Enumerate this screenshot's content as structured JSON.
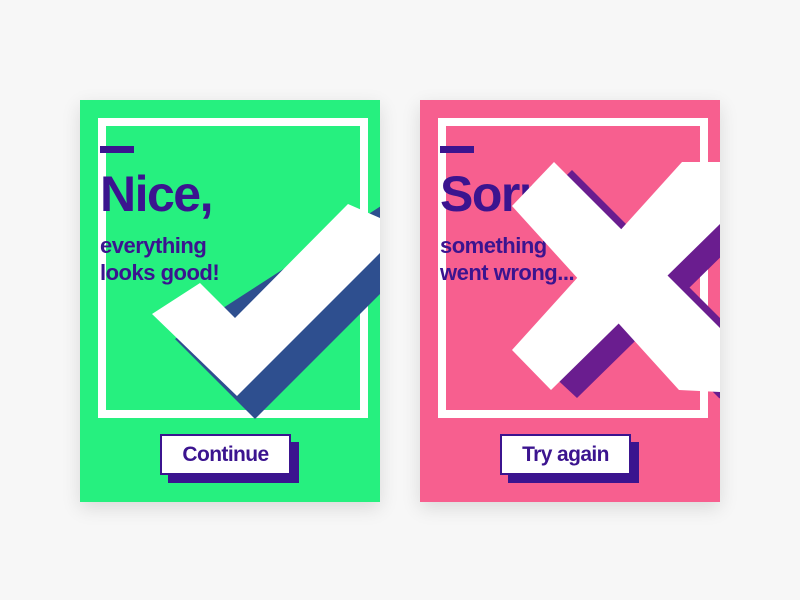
{
  "colors": {
    "page_background": "#f7f7f7",
    "success_background": "#26f07f",
    "error_background": "#f75f8f",
    "text_primary": "#3b148f",
    "checkmark_shadow": "#2e4f8f",
    "x_shadow": "#6a1d8f",
    "white": "#ffffff"
  },
  "success_card": {
    "heading": "Nice,",
    "subtext_line1": "everything",
    "subtext_line2": "looks good!",
    "button_label": "Continue",
    "icon": "checkmark-icon"
  },
  "error_card": {
    "heading": "Sorry,",
    "subtext_line1": "something",
    "subtext_line2": "went wrong...",
    "button_label": "Try again",
    "icon": "x-mark-icon"
  }
}
